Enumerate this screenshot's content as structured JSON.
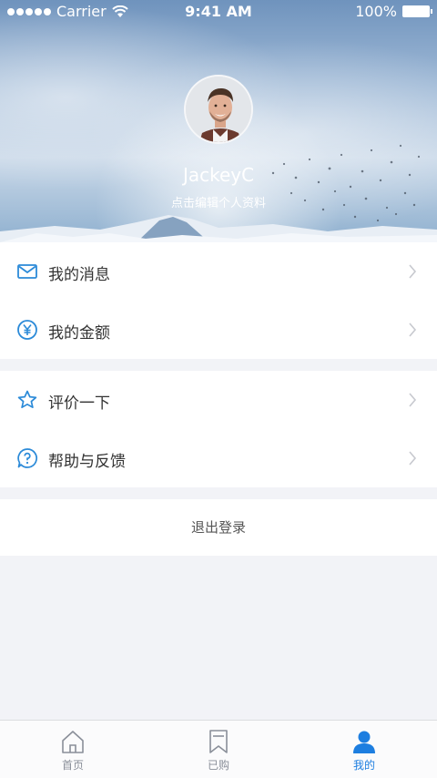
{
  "status_bar": {
    "carrier": "Carrier",
    "time": "9:41 AM",
    "battery": "100%"
  },
  "profile": {
    "username": "JackeyC",
    "edit_hint": "点击编辑个人资料"
  },
  "menu": {
    "group1": [
      {
        "label": "我的消息",
        "icon": "mail-icon"
      },
      {
        "label": "我的金额",
        "icon": "yuan-icon"
      }
    ],
    "group2": [
      {
        "label": "评价一下",
        "icon": "star-icon"
      },
      {
        "label": "帮助与反馈",
        "icon": "help-icon"
      }
    ]
  },
  "logout_label": "退出登录",
  "tabbar": {
    "tabs": [
      {
        "label": "首页",
        "icon": "home-icon",
        "active": false
      },
      {
        "label": "已购",
        "icon": "bookmark-icon",
        "active": false
      },
      {
        "label": "我的",
        "icon": "user-icon",
        "active": true
      }
    ]
  },
  "colors": {
    "accent": "#1d7ee0",
    "icon_blue": "#2b8ad8",
    "background": "#f2f3f7"
  }
}
